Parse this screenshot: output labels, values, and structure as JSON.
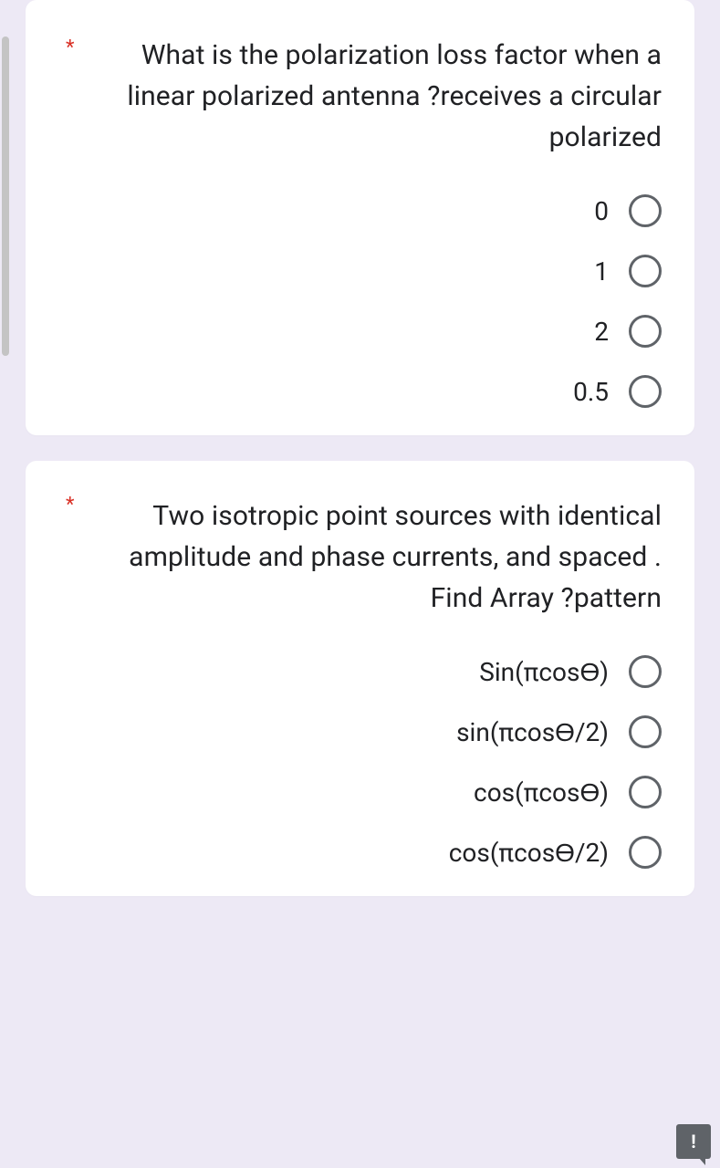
{
  "questions": [
    {
      "required_marker": "*",
      "text": "What is the polarization loss factor when a linear polarized antenna ?receives a circular polarized",
      "options": [
        "0",
        "1",
        "2",
        "0.5"
      ]
    },
    {
      "required_marker": "*",
      "text": "Two isotropic point sources with identical amplitude and phase currents, and spaced  . Find Array ?pattern",
      "options": [
        "Sin(πcosϴ)",
        "sin(πcosϴ/2)",
        "cos(πcosϴ)",
        "cos(πcosϴ/2)"
      ]
    }
  ],
  "feedback_icon_text": "!"
}
